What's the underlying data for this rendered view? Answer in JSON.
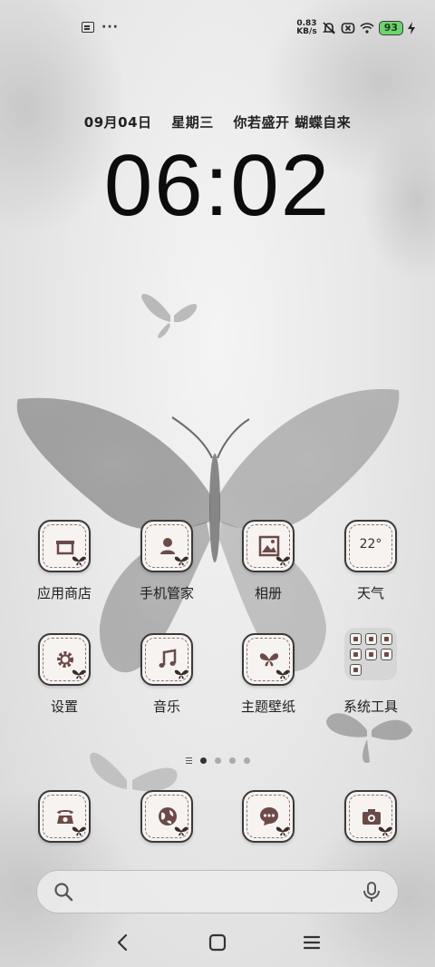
{
  "status_bar": {
    "net_speed_value": "0.83",
    "net_speed_unit": "KB/s",
    "battery": "93"
  },
  "lockscreen": {
    "date": "09月04日",
    "weekday": "星期三",
    "motto": "你若盛开 蝴蝶自来",
    "time": "06:02"
  },
  "apps": {
    "row1": [
      {
        "label": "应用商店",
        "icon": "store-icon"
      },
      {
        "label": "手机管家",
        "icon": "security-manager-icon"
      },
      {
        "label": "相册",
        "icon": "gallery-icon"
      },
      {
        "label": "天气",
        "icon": "weather-icon",
        "value": "22°"
      }
    ],
    "row2": [
      {
        "label": "设置",
        "icon": "settings-gear-icon"
      },
      {
        "label": "音乐",
        "icon": "music-note-icon"
      },
      {
        "label": "主题壁纸",
        "icon": "theme-butterfly-icon"
      },
      {
        "label": "系统工具",
        "icon": "system-tools-folder"
      }
    ]
  },
  "dock": [
    {
      "icon": "phone-icon"
    },
    {
      "icon": "browser-icon"
    },
    {
      "icon": "messages-icon"
    },
    {
      "icon": "camera-icon"
    }
  ],
  "pager": {
    "pages": 4,
    "active": 0
  },
  "colors": {
    "icon_glyph": "#6b4a47",
    "battery_fill": "#6fd36f",
    "icon_border": "#3a3a3a"
  }
}
